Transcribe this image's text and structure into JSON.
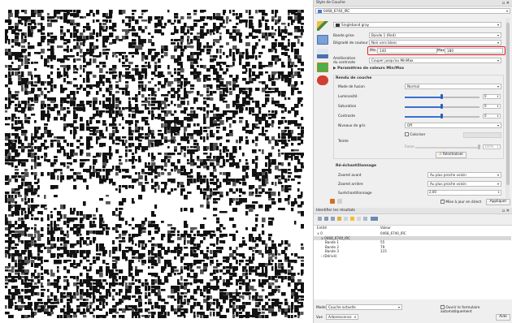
{
  "style_panel": {
    "title": "Style de Couche",
    "layer_name": "0468_6740_IRC",
    "renderer": "Singleband gray",
    "gray_band_label": "Bande grise",
    "gray_band_value": "Bande 1 (Red)",
    "color_gradient_label": "Dégradé de couleur",
    "color_gradient_value": "Noir vers blanc",
    "min_label": "Min",
    "min_value": "140",
    "max_label": "Max",
    "max_value": "180",
    "contrast_label_line1": "Amélioration",
    "contrast_label_line2": "du contraste",
    "contrast_value": "Couper jusqu'au MinMax",
    "minmax_section": "Paramètres de valeurs Min/Max",
    "render_section": "Rendu de couche",
    "blend_label": "Mode de fusion",
    "blend_value": "Normal",
    "brightness_label": "Luminosité",
    "brightness_value": "0",
    "saturation_label": "Saturation",
    "saturation_value": "0",
    "contrast2_label": "Contraste",
    "contrast2_value": "0",
    "grayscale_label": "Niveaux de gris",
    "grayscale_value": "Off",
    "colorize_label": "Coloriser",
    "hue_label": "Teinte",
    "force_label": "Force",
    "force_value": "100%",
    "reset_label": "Réinitialiser",
    "resample_section": "Ré-échantillonnage",
    "zoom_in_label": "Zoomé avant",
    "zoom_in_value": "Au plus proche voisin",
    "zoom_out_label": "Zoomé arrière",
    "zoom_out_value": "Au plus proche voisin",
    "oversample_label": "Suréchantillonnage",
    "oversample_value": "2,00",
    "live_update_label": "Mise à jour en direct",
    "apply_label": "Appliquer"
  },
  "identify_panel": {
    "title": "Identifier les résultats",
    "col_entity": "Entité",
    "col_value": "Valeur",
    "rows": [
      {
        "indent": 0,
        "toggle": "∨",
        "name": "0",
        "value": "0468_6740_IRC"
      },
      {
        "indent": 1,
        "toggle": "∨",
        "name": "0468_6740_IRC",
        "value": ""
      },
      {
        "indent": 2,
        "toggle": "",
        "name": "Bande 1",
        "value": "55"
      },
      {
        "indent": 2,
        "toggle": "",
        "name": "Bande 2",
        "value": "79"
      },
      {
        "indent": 2,
        "toggle": "",
        "name": "Bande 3",
        "value": "115"
      },
      {
        "indent": 1,
        "toggle": "›",
        "name": "(Dérivé)",
        "value": ""
      }
    ],
    "mode_label": "Mode",
    "mode_value": "Couche actuelle",
    "view_label": "Vue",
    "view_value": "Arborescence",
    "auto_form_label": "Ouvrir le formulaire automatiquement",
    "help_label": "Aide"
  },
  "colors": {
    "highlight_border": "#e0202a",
    "selected_row": "#d8d8d8",
    "accent": "#3a6fcf"
  }
}
